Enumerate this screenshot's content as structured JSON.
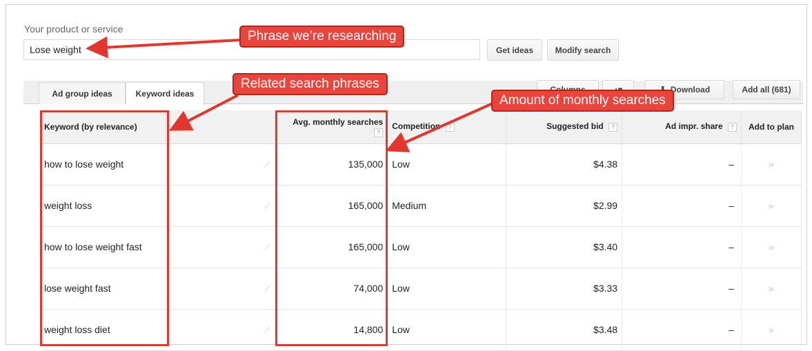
{
  "header": {
    "product_label": "Your product or service",
    "search_value": "Lose weight",
    "get_ideas": "Get ideas",
    "modify_search": "Modify search"
  },
  "tabs": [
    {
      "label": "Ad group ideas"
    },
    {
      "label": "Keyword ideas"
    }
  ],
  "toolbar": {
    "columns": "Columns",
    "download": "Download",
    "add_all": "Add all (681)"
  },
  "table": {
    "columns": {
      "keyword": "Keyword (by relevance)",
      "avg_monthly": "Avg. monthly searches",
      "competition": "Competition",
      "suggested_bid": "Suggested bid",
      "ad_impr_share": "Ad impr. share",
      "add_to_plan": "Add to plan"
    },
    "help_glyph": "?",
    "rows": [
      {
        "keyword": "how to lose weight",
        "searches": "135,000",
        "competition": "Low",
        "bid": "$4.38",
        "share": "–",
        "add": "»"
      },
      {
        "keyword": "weight loss",
        "searches": "165,000",
        "competition": "Medium",
        "bid": "$2.99",
        "share": "–",
        "add": "»"
      },
      {
        "keyword": "how to lose weight fast",
        "searches": "165,000",
        "competition": "Low",
        "bid": "$3.40",
        "share": "–",
        "add": "»"
      },
      {
        "keyword": "lose weight fast",
        "searches": "74,000",
        "competition": "Low",
        "bid": "$3.33",
        "share": "–",
        "add": "»"
      },
      {
        "keyword": "weight loss diet",
        "searches": "14,800",
        "competition": "Low",
        "bid": "$3.48",
        "share": "–",
        "add": "»"
      }
    ]
  },
  "annotations": {
    "phrase": "Phrase we’re researching",
    "related": "Related search phrases",
    "monthly": "Amount of monthly searches"
  },
  "colors": {
    "annotation_red": "#e8453c",
    "annotation_border": "#e2372e",
    "header_bg": "#f1f1f1"
  },
  "icons": {
    "trend": "chart-trend-icon",
    "add": "add-to-plan-icon",
    "download": "download-icon"
  }
}
